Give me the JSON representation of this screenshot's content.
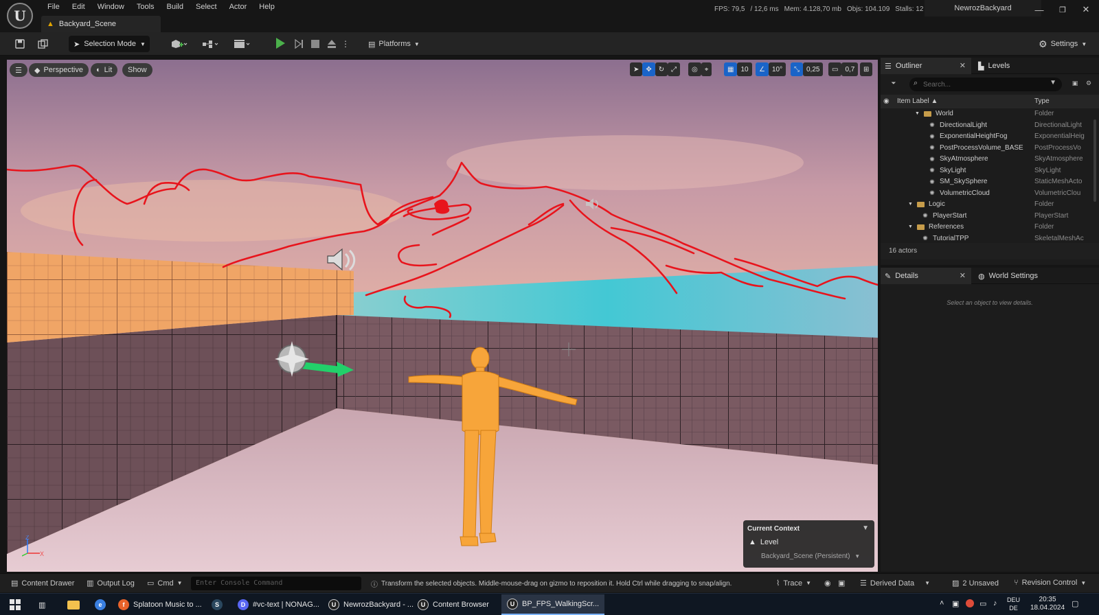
{
  "menu": [
    "File",
    "Edit",
    "Window",
    "Tools",
    "Build",
    "Select",
    "Actor",
    "Help"
  ],
  "tab": {
    "title": "Backyard_Scene"
  },
  "stats": {
    "fps": "FPS: 79,5",
    "ms": "/ 12,6 ms",
    "mem": "Mem: 4.128,70 mb",
    "objs": "Objs: 104.109",
    "stalls": "Stalls: 12"
  },
  "project_name": "NewrozBackyard",
  "toolbar": {
    "selection_mode": "Selection Mode",
    "platforms": "Platforms",
    "settings": "Settings"
  },
  "viewport": {
    "perspective": "Perspective",
    "lit": "Lit",
    "show": "Show",
    "grid_snap": "10",
    "rotation_snap": "10°",
    "scale_snap": "0,25",
    "camera_speed": "0,7",
    "context_title": "Current Context",
    "context_level": "Level",
    "context_scene": "Backyard_Scene (Persistent)",
    "axis_z": "Z",
    "axis_x": "X"
  },
  "outliner": {
    "tab_outliner": "Outliner",
    "tab_levels": "Levels",
    "search_placeholder": "Search...",
    "col_label": "Item Label ▲",
    "col_type": "Type",
    "items": [
      {
        "label": "World",
        "type": "Folder",
        "indent": 1,
        "kind": "folder"
      },
      {
        "label": "DirectionalLight",
        "type": "DirectionalLight",
        "indent": 2,
        "kind": "icon"
      },
      {
        "label": "ExponentialHeightFog",
        "type": "ExponentialHeig",
        "indent": 2,
        "kind": "icon"
      },
      {
        "label": "PostProcessVolume_BASE",
        "type": "PostProcessVo",
        "indent": 2,
        "kind": "icon"
      },
      {
        "label": "SkyAtmosphere",
        "type": "SkyAtmosphere",
        "indent": 2,
        "kind": "icon"
      },
      {
        "label": "SkyLight",
        "type": "SkyLight",
        "indent": 2,
        "kind": "icon"
      },
      {
        "label": "SM_SkySphere",
        "type": "StaticMeshActo",
        "indent": 2,
        "kind": "icon"
      },
      {
        "label": "VolumetricCloud",
        "type": "VolumetricClou",
        "indent": 2,
        "kind": "icon"
      },
      {
        "label": "Logic",
        "type": "Folder",
        "indent": 0,
        "kind": "folder"
      },
      {
        "label": "PlayerStart",
        "type": "PlayerStart",
        "indent": 1,
        "kind": "icon"
      },
      {
        "label": "References",
        "type": "Folder",
        "indent": 0,
        "kind": "folder"
      },
      {
        "label": "TutorialTPP",
        "type": "SkeletalMeshAc",
        "indent": 1,
        "kind": "icon"
      }
    ],
    "actor_count": "16 actors"
  },
  "details": {
    "tab_details": "Details",
    "tab_world": "World Settings",
    "empty_msg": "Select an object to view details."
  },
  "status": {
    "content_drawer": "Content Drawer",
    "output_log": "Output Log",
    "cmd": "Cmd",
    "console_placeholder": "Enter Console Command",
    "hint": "Transform the selected objects. Middle-mouse-drag on gizmo to reposition it. Hold Ctrl while dragging to snap/align.",
    "trace": "Trace",
    "derived_data": "Derived Data",
    "unsaved": "2 Unsaved",
    "revision": "Revision Control"
  },
  "taskbar": {
    "tasks": [
      "Splatoon Music to ...",
      "#vc-text | NONAG...",
      "NewrozBackyard - ...",
      "Content Browser",
      "BP_FPS_WalkingScr..."
    ],
    "lang1": "DEU",
    "lang2": "DE",
    "time": "20:35",
    "date": "18.04.2024"
  }
}
